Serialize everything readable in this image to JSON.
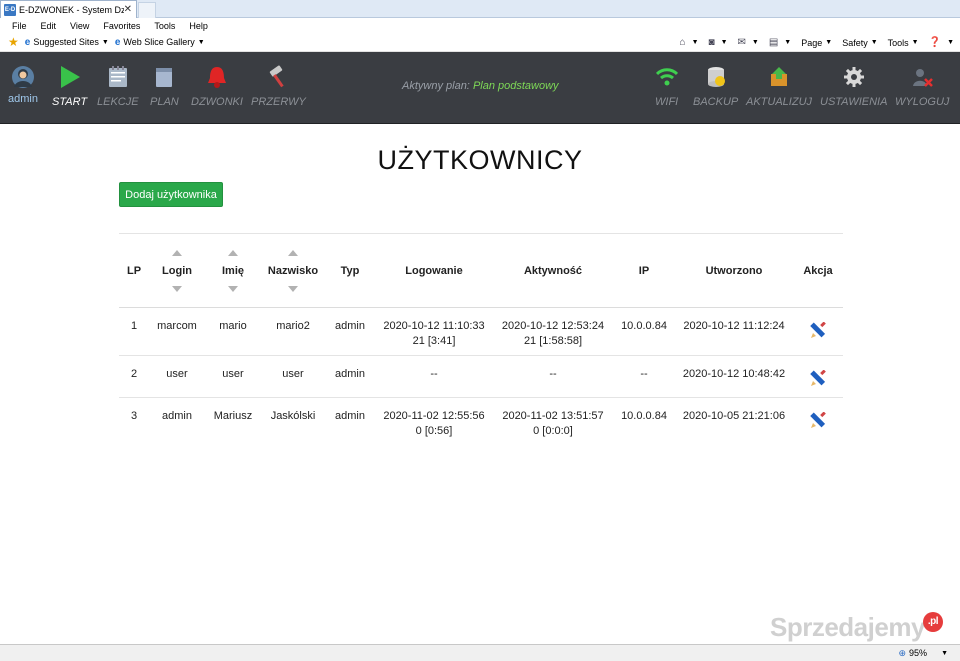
{
  "browser": {
    "tab_title": "E-DZWONEK - System Dzw...",
    "tab_close": "✕",
    "favicon_text": "E-D",
    "menu": [
      "File",
      "Edit",
      "View",
      "Favorites",
      "Tools",
      "Help"
    ],
    "favorites": {
      "suggested": "Suggested Sites",
      "web_slice": "Web Slice Gallery"
    },
    "commands": {
      "page": "Page",
      "safety": "Safety",
      "tools": "Tools"
    },
    "zoom": "95%"
  },
  "toolbar": {
    "user": "admin",
    "items": [
      "START",
      "LEKCJE",
      "PLAN",
      "DZWONKI",
      "PRZERWY"
    ],
    "right_items": [
      "WIFI",
      "BACKUP",
      "AKTUALIZUJ",
      "USTAWIENIA",
      "WYLOGUJ"
    ],
    "plan_label": "Aktywny plan:",
    "plan_name": "Plan podstawowy"
  },
  "page": {
    "title": "UŻYTKOWNICY",
    "add_button": "Dodaj użytkownika"
  },
  "table": {
    "headers": [
      "LP",
      "Login",
      "Imię",
      "Nazwisko",
      "Typ",
      "Logowanie",
      "Aktywność",
      "IP",
      "Utworzono",
      "Akcja"
    ],
    "rows": [
      {
        "lp": "1",
        "login": "marcom",
        "imie": "mario",
        "nazwisko": "mario2",
        "typ": "admin",
        "logowanie": "2020-10-12 11:10:33",
        "logowanie2": "21 [3:41]",
        "aktywnosc": "2020-10-12 12:53:24",
        "aktywnosc2": "21 [1:58:58]",
        "ip": "10.0.0.84",
        "utworzono": "2020-10-12 11:12:24"
      },
      {
        "lp": "2",
        "login": "user",
        "imie": "user",
        "nazwisko": "user",
        "typ": "admin",
        "logowanie": "--",
        "logowanie2": "",
        "aktywnosc": "--",
        "aktywnosc2": "",
        "ip": "--",
        "utworzono": "2020-10-12 10:48:42"
      },
      {
        "lp": "3",
        "login": "admin",
        "imie": "Mariusz",
        "nazwisko": "Jaskólski",
        "typ": "admin",
        "logowanie": "2020-11-02 12:55:56",
        "logowanie2": "0 [0:56]",
        "aktywnosc": "2020-11-02 13:51:57",
        "aktywnosc2": "0 [0:0:0]",
        "ip": "10.0.0.84",
        "utworzono": "2020-10-05 21:21:06"
      }
    ]
  },
  "watermark": {
    "text": "Sprzedajemy",
    "badge": ".pl"
  },
  "colors": {
    "toolbar_bg": "#3a3d42",
    "accent_green": "#2aa84a",
    "plan_green": "#7ed957"
  }
}
